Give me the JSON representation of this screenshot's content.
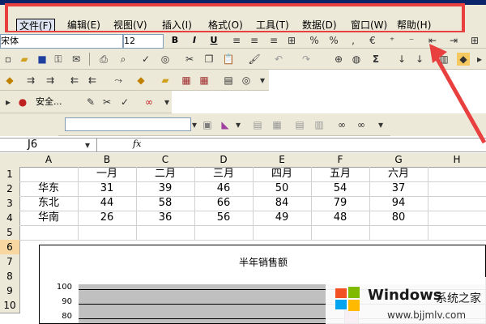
{
  "menu": {
    "items": [
      "文件(F)",
      "编辑(E)",
      "视图(V)",
      "插入(I)",
      "格式(O)",
      "工具(T)",
      "数据(D)",
      "窗口(W)",
      "帮助(H)"
    ]
  },
  "format_toolbar": {
    "font": "宋体",
    "size": "12",
    "bold": "B",
    "italic": "I",
    "underline": "U"
  },
  "macro_toolbar": {
    "security": "安全..."
  },
  "formula_bar": {
    "name_box": "J6",
    "fx": "fx"
  },
  "sheet": {
    "columns": [
      "A",
      "B",
      "C",
      "D",
      "E",
      "F",
      "G",
      "H"
    ],
    "rows": [
      "1",
      "2",
      "3",
      "4",
      "5",
      "6",
      "7",
      "8",
      "9",
      "10"
    ],
    "header_row": [
      "",
      "一月",
      "二月",
      "三月",
      "四月",
      "五月",
      "六月"
    ],
    "data_rows": [
      [
        "华东",
        "31",
        "39",
        "46",
        "50",
        "54",
        "37"
      ],
      [
        "东北",
        "44",
        "58",
        "66",
        "84",
        "79",
        "94"
      ],
      [
        "华南",
        "26",
        "36",
        "56",
        "49",
        "48",
        "80"
      ]
    ]
  },
  "chart": {
    "title": "半年销售额",
    "yticks": [
      "100",
      "90",
      "80"
    ]
  },
  "watermark": {
    "brand": "Windows",
    "site_cn": "系统之家",
    "url": "www.bjjmlv.com"
  },
  "colors": {
    "highlight_box": "#e8403f",
    "toolbar_bg": "#ece9d8",
    "plot_bg": "#c0c0c0"
  }
}
